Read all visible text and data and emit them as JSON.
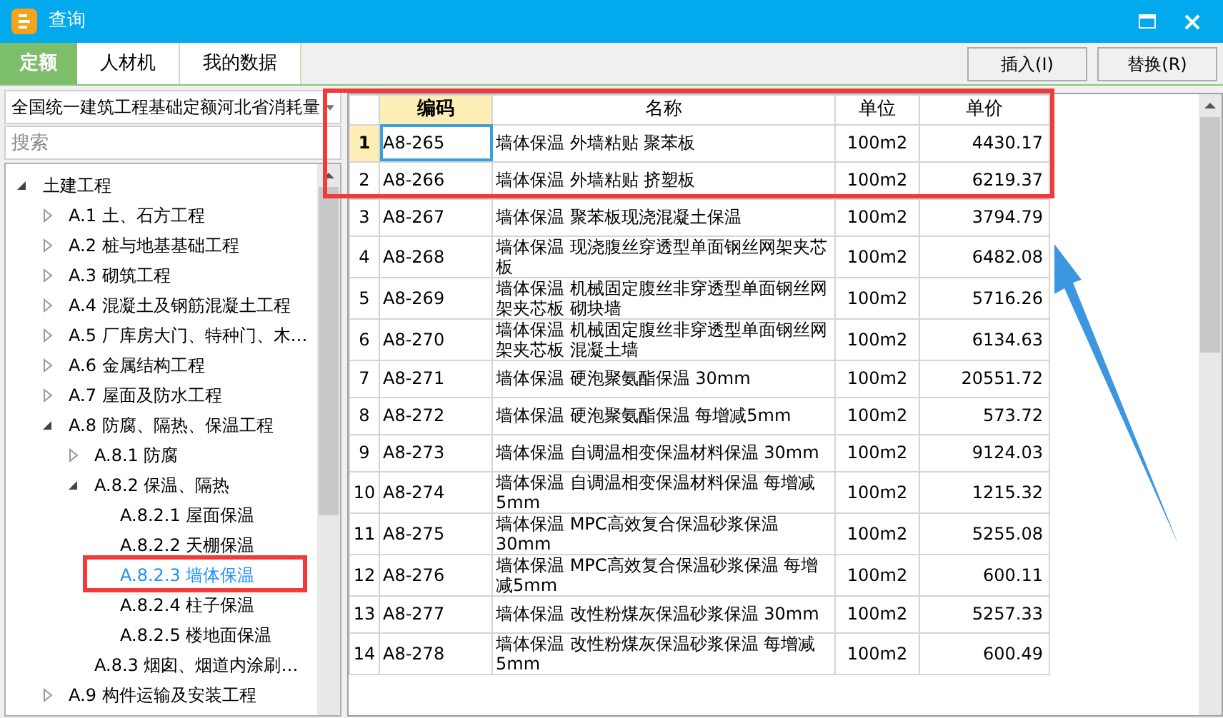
{
  "window": {
    "title": "查询"
  },
  "tabs": [
    {
      "label": "定额",
      "selected": true
    },
    {
      "label": "人材机",
      "selected": false
    },
    {
      "label": "我的数据",
      "selected": false
    }
  ],
  "buttons": [
    "插入(I)",
    "替换(R)"
  ],
  "library": {
    "value": "全国统一建筑工程基础定额河北省消耗量"
  },
  "search": {
    "placeholder": "搜索"
  },
  "tree": [
    {
      "label": "土建工程",
      "expanded": true,
      "selected": false,
      "children": [
        {
          "label": "A.1 土、石方工程",
          "expanded": false,
          "selected": false
        },
        {
          "label": "A.2 桩与地基基础工程",
          "expanded": false,
          "selected": false
        },
        {
          "label": "A.3 砌筑工程",
          "expanded": false,
          "selected": false
        },
        {
          "label": "A.4 混凝土及钢筋混凝土工程",
          "expanded": false,
          "selected": false
        },
        {
          "label": "A.5 厂库房大门、特种门、木…",
          "expanded": false,
          "selected": false
        },
        {
          "label": "A.6 金属结构工程",
          "expanded": false,
          "selected": false
        },
        {
          "label": "A.7 屋面及防水工程",
          "expanded": false,
          "selected": false
        },
        {
          "label": "A.8 防腐、隔热、保温工程",
          "expanded": true,
          "selected": false,
          "children": [
            {
              "label": "A.8.1 防腐",
              "expanded": false,
              "selected": false
            },
            {
              "label": "A.8.2 保温、隔热",
              "expanded": true,
              "selected": false,
              "children": [
                {
                  "label": "A.8.2.1 屋面保温",
                  "selected": false
                },
                {
                  "label": "A.8.2.2 天棚保温",
                  "selected": false
                },
                {
                  "label": "A.8.2.3 墙体保温",
                  "selected": true
                },
                {
                  "label": "A.8.2.4 柱子保温",
                  "selected": false
                },
                {
                  "label": "A.8.2.5 楼地面保温",
                  "selected": false
                }
              ]
            },
            {
              "label": "A.8.3 烟囱、烟道内涂刷…",
              "selected": false
            }
          ]
        },
        {
          "label": "A.9 构件运输及安装工程",
          "expanded": false,
          "selected": false
        }
      ]
    }
  ],
  "table": {
    "columns": [
      "编码",
      "名称",
      "单位",
      "单价"
    ],
    "rows": [
      {
        "number": "1",
        "code": "A8-265",
        "name": "墙体保温 外墙粘贴 聚苯板",
        "unit": "100m2",
        "price": "4430.17",
        "selected": true
      },
      {
        "number": "2",
        "code": "A8-266",
        "name": "墙体保温 外墙粘贴 挤塑板",
        "unit": "100m2",
        "price": "6219.37",
        "selected": false
      },
      {
        "number": "3",
        "code": "A8-267",
        "name": "墙体保温 聚苯板现浇混凝土保温",
        "unit": "100m2",
        "price": "3794.79",
        "selected": false
      },
      {
        "number": "4",
        "code": "A8-268",
        "name": "墙体保温 现浇腹丝穿透型单面钢丝网架夹芯板",
        "unit": "100m2",
        "price": "6482.08",
        "selected": false
      },
      {
        "number": "5",
        "code": "A8-269",
        "name": "墙体保温 机械固定腹丝非穿透型单面钢丝网架夹芯板 砌块墙",
        "unit": "100m2",
        "price": "5716.26",
        "selected": false
      },
      {
        "number": "6",
        "code": "A8-270",
        "name": "墙体保温 机械固定腹丝非穿透型单面钢丝网架夹芯板 混凝土墙",
        "unit": "100m2",
        "price": "6134.63",
        "selected": false
      },
      {
        "number": "7",
        "code": "A8-271",
        "name": "墙体保温 硬泡聚氨酯保温 30mm",
        "unit": "100m2",
        "price": "20551.72",
        "selected": false
      },
      {
        "number": "8",
        "code": "A8-272",
        "name": "墙体保温 硬泡聚氨酯保温 每增减5mm",
        "unit": "100m2",
        "price": "573.72",
        "selected": false
      },
      {
        "number": "9",
        "code": "A8-273",
        "name": "墙体保温 自调温相变保温材料保温 30mm",
        "unit": "100m2",
        "price": "9124.03",
        "selected": false
      },
      {
        "number": "10",
        "code": "A8-274",
        "name": "墙体保温 自调温相变保温材料保温 每增减5mm",
        "unit": "100m2",
        "price": "1215.32",
        "selected": false
      },
      {
        "number": "11",
        "code": "A8-275",
        "name": "墙体保温 MPC高效复合保温砂浆保温 30mm",
        "unit": "100m2",
        "price": "5255.08",
        "selected": false
      },
      {
        "number": "12",
        "code": "A8-276",
        "name": "墙体保温 MPC高效复合保温砂浆保温 每增减5mm",
        "unit": "100m2",
        "price": "600.11",
        "selected": false
      },
      {
        "number": "13",
        "code": "A8-277",
        "name": "墙体保温 改性粉煤灰保温砂浆保温 30mm",
        "unit": "100m2",
        "price": "5257.33",
        "selected": false
      },
      {
        "number": "14",
        "code": "A8-278",
        "name": "墙体保温 改性粉煤灰保温砂浆保温 每增减5mm",
        "unit": "100m2",
        "price": "600.49",
        "selected": false
      }
    ]
  }
}
